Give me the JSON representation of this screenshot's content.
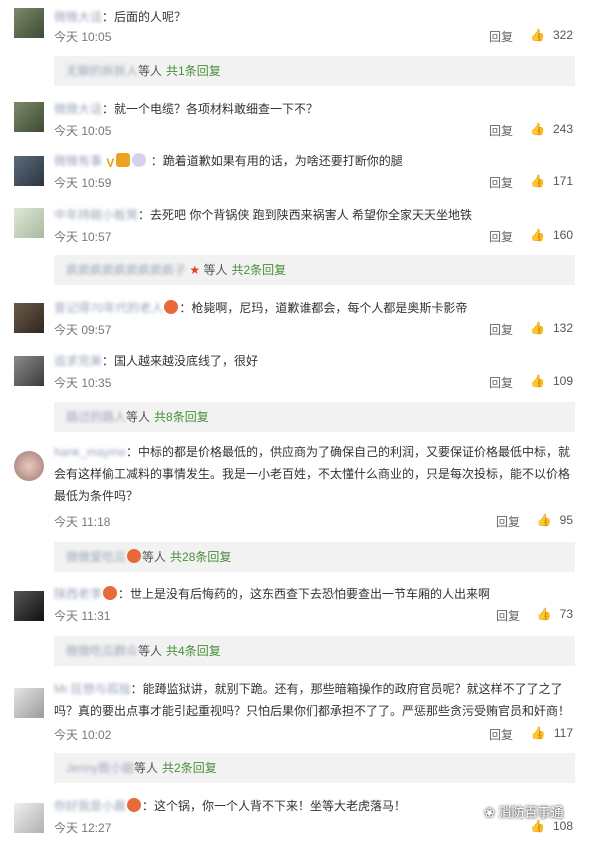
{
  "comments": [
    {
      "name": "微微大话",
      "text": "：后面的人呢？",
      "time": "今天 10:05",
      "reply": "回复",
      "likes": "322",
      "sub": {
        "names": "无聊的拆拆人",
        "and": "等人",
        "count": "共1条回复"
      }
    },
    {
      "name": "微微大话",
      "text": "：就一个电缆？各项材料敢细查一下不？",
      "time": "今天 10:05",
      "reply": "回复",
      "likes": "243"
    },
    {
      "name": "微微有事",
      "text": "：跪着道歉如果有用的话，为啥还要打断你的腿",
      "time": "今天 10:59",
      "reply": "回复",
      "likes": "171"
    },
    {
      "name": "中年持碗小板凳",
      "text": "：去死吧 你个背锅侠 跑到陕西来祸害人 希望你全家天天坐地铁",
      "time": "今天 10:57",
      "reply": "回复",
      "likes": "160",
      "sub": {
        "names": "疯疯疯疯疯疯疯疯疯子",
        "and": "等人",
        "count": "共2条回复"
      }
    },
    {
      "name": "曾记得70年代的老人",
      "text": "：枪毙啊，尼玛，道歉谁都会，每个人都是奥斯卡影帝",
      "time": "今天 09:57",
      "reply": "回复",
      "likes": "132"
    },
    {
      "name": "追求完美",
      "text": "：国人越来越没底线了，很好",
      "time": "今天 10:35",
      "reply": "回复",
      "likes": "109",
      "sub": {
        "names": "路过的路人",
        "and": "等人",
        "count": "共8条回复"
      }
    },
    {
      "name": "hank_mayme",
      "text": "：中标的都是价格最低的，供应商为了确保自己的利润，又要保证价格最低中标，就会有这样偷工减料的事情发生。我是一小老百姓，不太懂什么商业的，只是每次投标，能不以价格最低为条件吗？",
      "time": "今天 11:18",
      "reply": "回复",
      "likes": "95",
      "sub": {
        "names": "微微爱吃瓜",
        "and": "等人",
        "count": "共28条回复"
      }
    },
    {
      "name": "陕西老李",
      "text": "：世上是没有后悔药的，这东西查下去恐怕要查出一节车厢的人出来啊",
      "time": "今天 11:31",
      "reply": "回复",
      "likes": "73",
      "sub": {
        "names": "微微吃瓜群众",
        "and": "等人",
        "count": "共4条回复"
      }
    },
    {
      "name": "Mr.狂想与孤独",
      "text": "：能蹲监狱讲，就别下跪。还有，那些暗箱操作的政府官员呢？就这样不了了之了吗？真的要出点事才能引起重视吗？只怕后果你们都承担不了了。严惩那些贪污受贿官员和奸商！",
      "time": "今天 10:02",
      "reply": "回复",
      "likes": "117",
      "sub": {
        "names": "Jenny我小姐",
        "and": "等人",
        "count": "共2条回复"
      }
    },
    {
      "name": "你好我是小晨",
      "text": "：这个锅，你一个人背不下来！坐等大老虎落马！",
      "time": "今天 12:27",
      "reply": "回复",
      "likes": "108"
    }
  ],
  "watermark": "消防百事通",
  "icons": {
    "like": "thumbs-up-icon",
    "vip": "v-badge-icon"
  }
}
